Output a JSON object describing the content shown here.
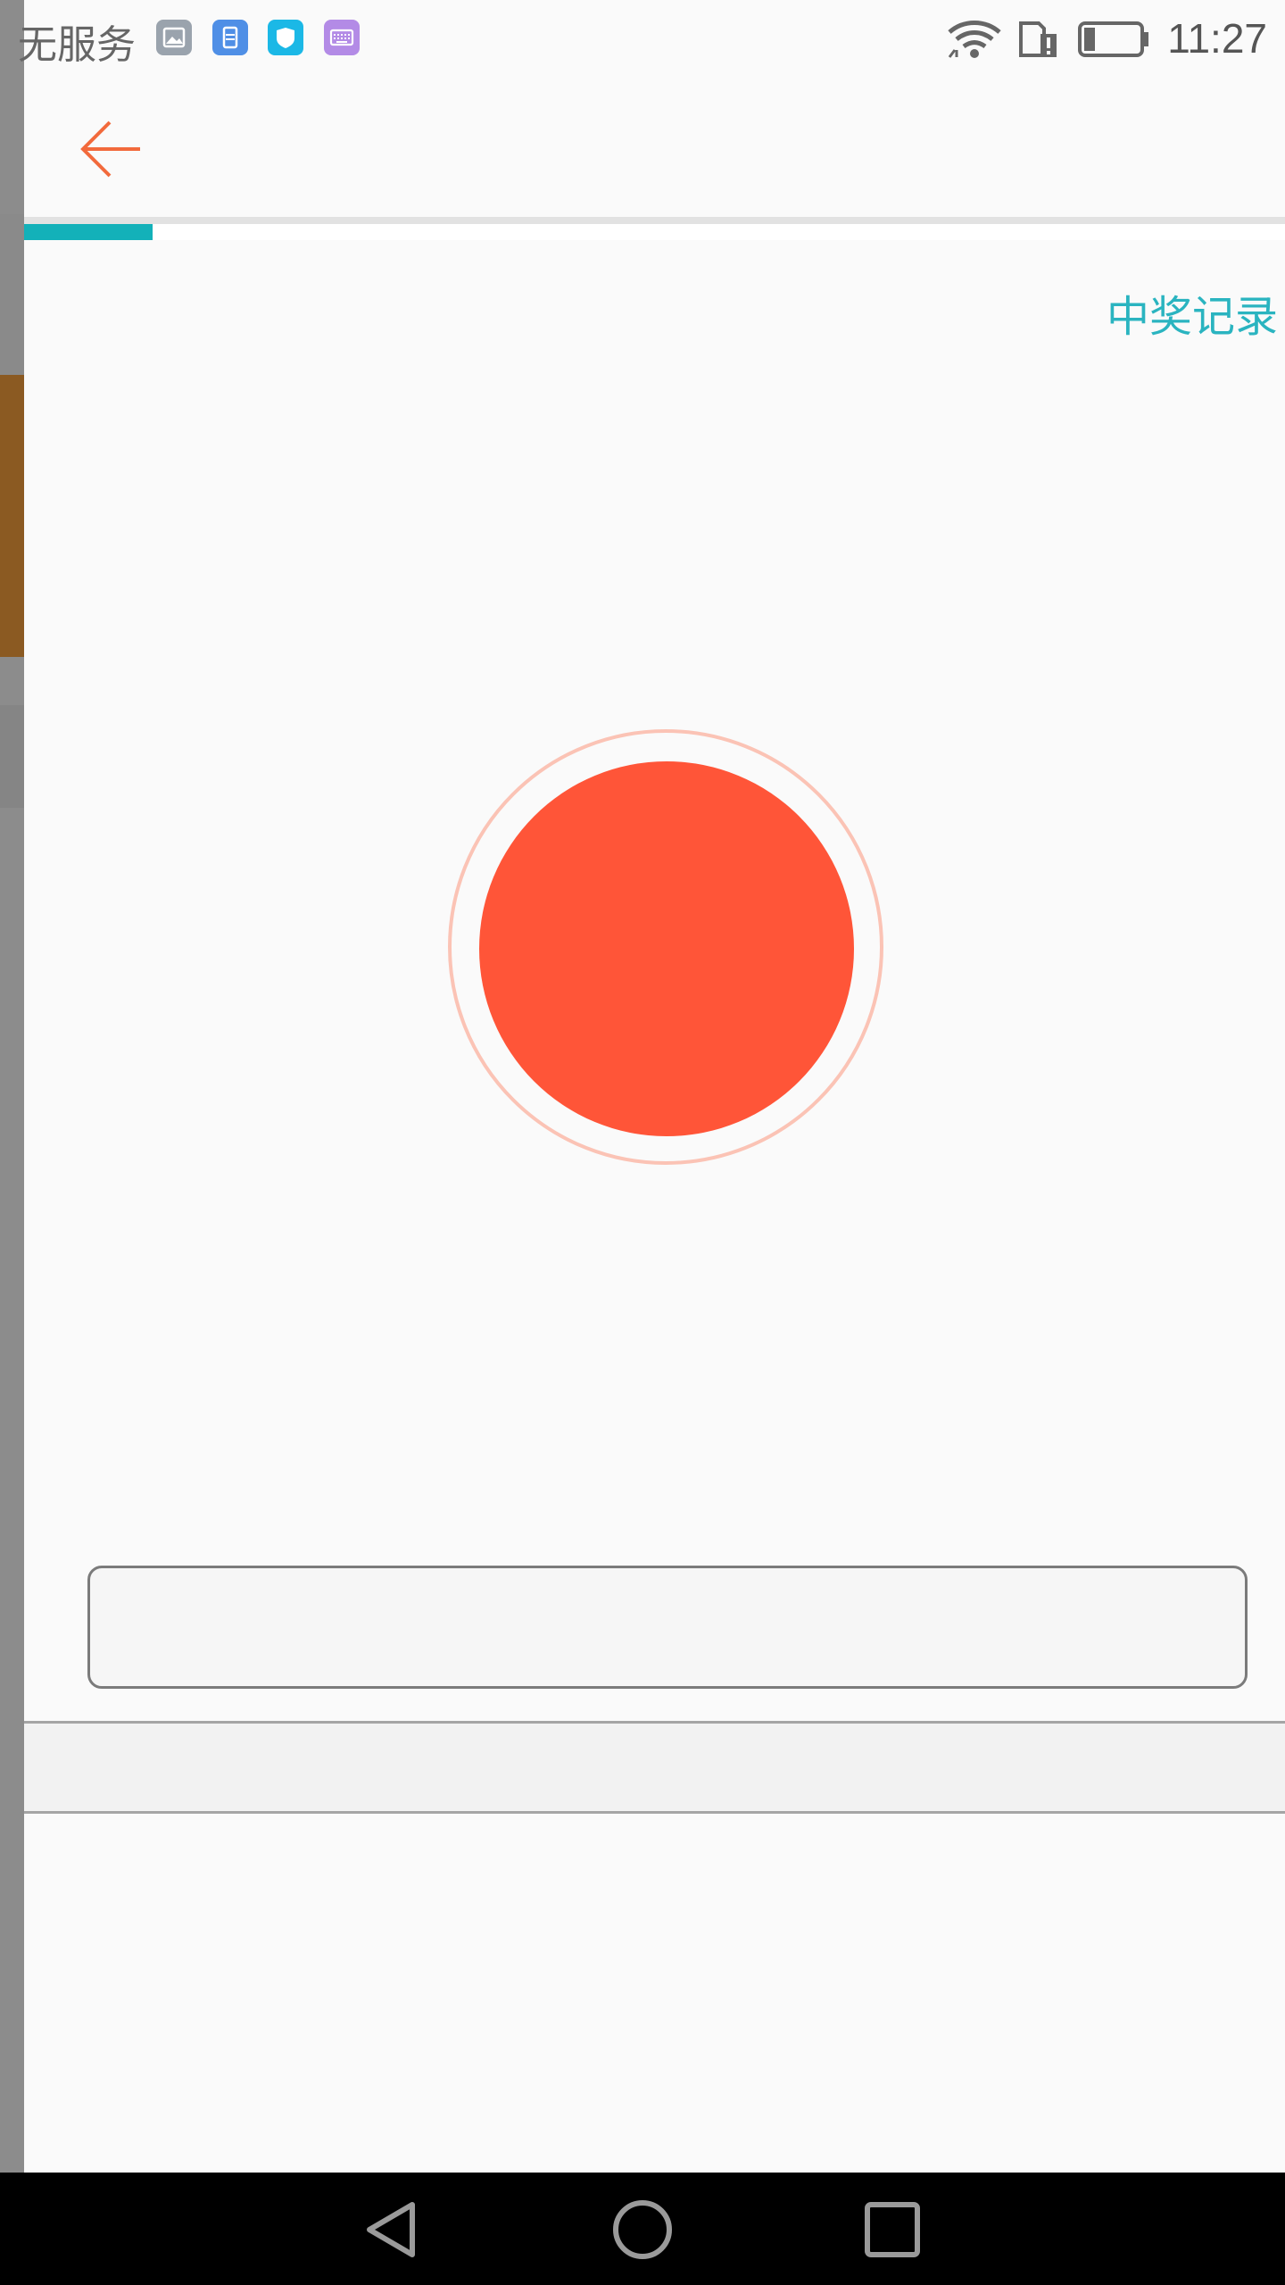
{
  "status_bar": {
    "carrier": "无服务",
    "time": "11:27",
    "app_icons": [
      "gallery-icon",
      "file-manager-icon",
      "shield-icon",
      "keyboard-icon"
    ],
    "right_icons": [
      "wifi-icon",
      "sim-alert-icon",
      "battery-icon"
    ],
    "battery_level": 0.2
  },
  "toolbar": {
    "back_icon": "arrow-left-icon",
    "accent_color": "#f26a3c"
  },
  "progress": {
    "value": 0.102,
    "color": "#13b1b9"
  },
  "records_link": "中奖记录",
  "record_button": {
    "icon": "record-button",
    "color": "#ff5538",
    "ring_color": "#fbc3b5"
  },
  "input": {
    "value": "",
    "placeholder": ""
  },
  "nav": {
    "back": "nav-back-icon",
    "home": "nav-home-icon",
    "recents": "nav-recents-icon"
  }
}
